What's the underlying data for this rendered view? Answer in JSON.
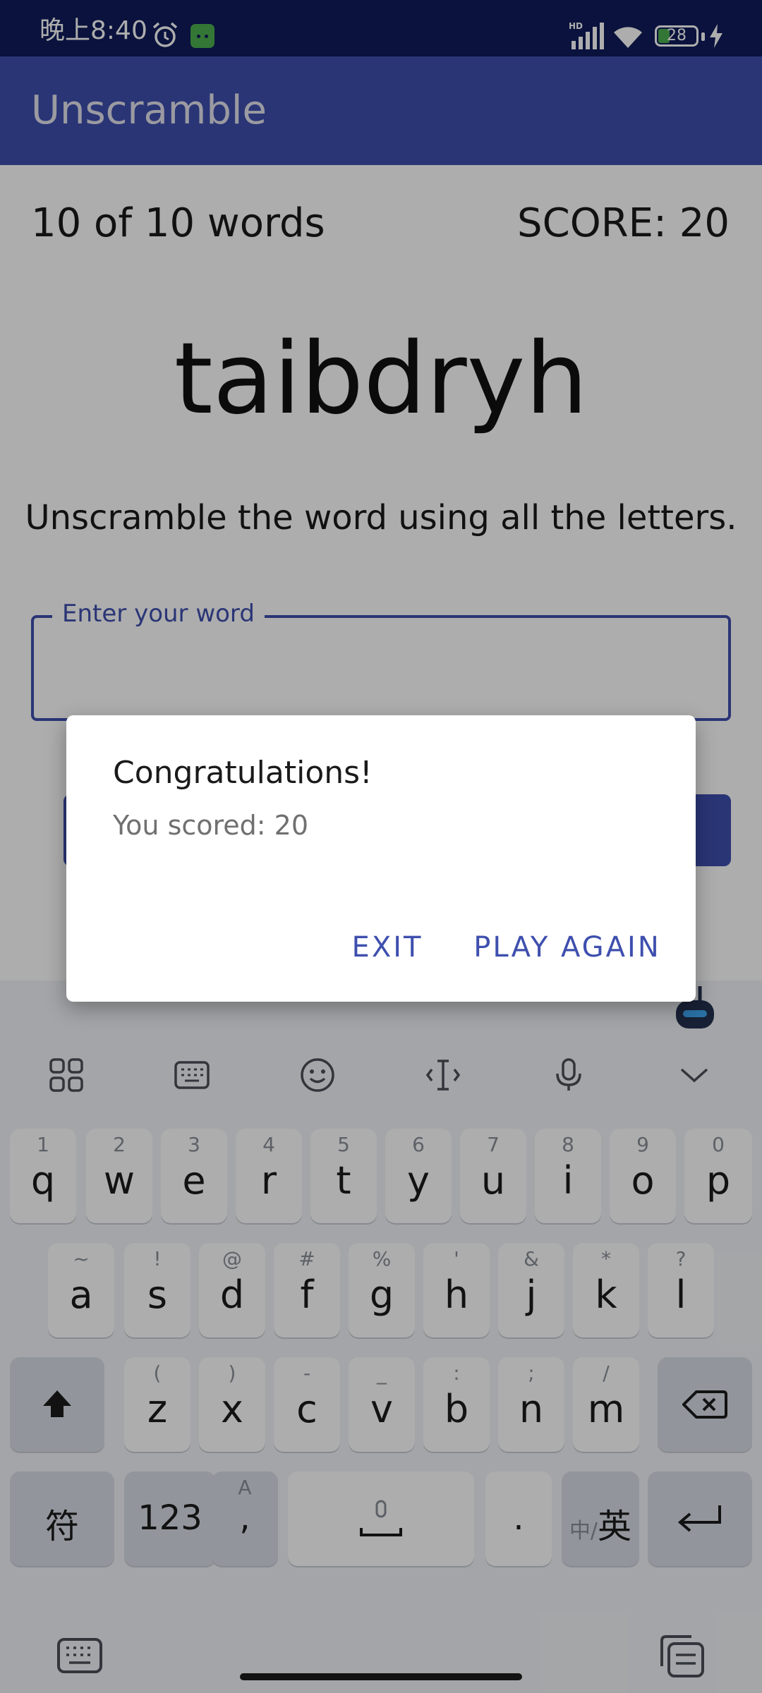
{
  "status_bar": {
    "time": "晚上8:40",
    "network_label": "HD",
    "battery_level": "28",
    "icons": [
      "alarm-icon",
      "android-notification-icon",
      "signal-icon",
      "wifi-icon",
      "battery-icon",
      "charging-icon"
    ]
  },
  "app_bar": {
    "title": "Unscramble"
  },
  "game": {
    "word_count": "10 of 10 words",
    "score": "SCORE: 20",
    "scrambled_word": "taibdryh",
    "instructions": "Unscramble the word using all the letters.",
    "input_label": "Enter your word",
    "input_value": ""
  },
  "dialog": {
    "title": "Congratulations!",
    "message": "You scored: 20",
    "exit_label": "EXIT",
    "play_again_label": "PLAY AGAIN"
  },
  "keyboard": {
    "toolbar_icons": [
      "apps-grid-icon",
      "keyboard-layout-icon",
      "emoji-icon",
      "text-cursor-icon",
      "microphone-icon",
      "collapse-chevron-icon"
    ],
    "row1": [
      {
        "key": "q",
        "hint": "1"
      },
      {
        "key": "w",
        "hint": "2"
      },
      {
        "key": "e",
        "hint": "3"
      },
      {
        "key": "r",
        "hint": "4"
      },
      {
        "key": "t",
        "hint": "5"
      },
      {
        "key": "y",
        "hint": "6"
      },
      {
        "key": "u",
        "hint": "7"
      },
      {
        "key": "i",
        "hint": "8"
      },
      {
        "key": "o",
        "hint": "9"
      },
      {
        "key": "p",
        "hint": "0"
      }
    ],
    "row2": [
      {
        "key": "a",
        "hint": "~"
      },
      {
        "key": "s",
        "hint": "!"
      },
      {
        "key": "d",
        "hint": "@"
      },
      {
        "key": "f",
        "hint": "#"
      },
      {
        "key": "g",
        "hint": "%"
      },
      {
        "key": "h",
        "hint": "'"
      },
      {
        "key": "j",
        "hint": "&"
      },
      {
        "key": "k",
        "hint": "*"
      },
      {
        "key": "l",
        "hint": "?"
      }
    ],
    "row3": [
      {
        "key": "z",
        "hint": "("
      },
      {
        "key": "x",
        "hint": ")"
      },
      {
        "key": "c",
        "hint": "-"
      },
      {
        "key": "v",
        "hint": "_"
      },
      {
        "key": "b",
        "hint": ":"
      },
      {
        "key": "n",
        "hint": ";"
      },
      {
        "key": "m",
        "hint": "/"
      }
    ],
    "symbols_label": "符",
    "numbers_label": "123",
    "comma_label": ",",
    "comma_hint": "A",
    "period_label": ".",
    "lang_small": "中/",
    "lang_large": "英"
  },
  "colors": {
    "status_bar": "#0f1b5a",
    "app_bar": "#3e4fae",
    "accent": "#3e4fae",
    "scrim": "rgba(0,0,0,0.32)"
  }
}
